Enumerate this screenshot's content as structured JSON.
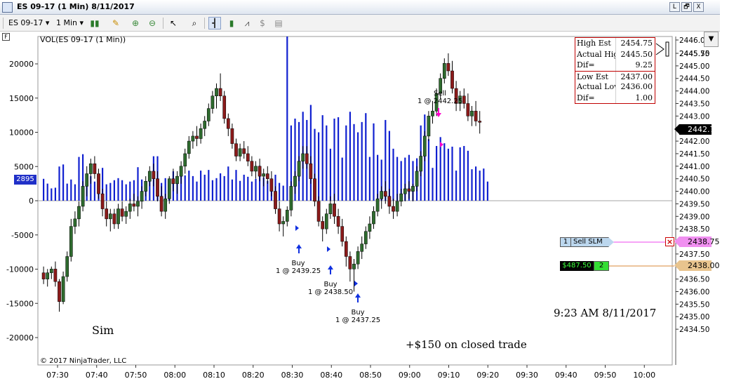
{
  "window": {
    "title": "ES 09-17 (1 Min)  8/11/2017",
    "icon": "chart-window-icon",
    "buttons": {
      "minimize": "L",
      "restore": "🗗",
      "close": "X"
    }
  },
  "toolbar": {
    "instrument": "ES 09-17",
    "interval": "1 Min",
    "icons": [
      "candlestick-icon",
      "pencil-icon",
      "zoom-in-icon",
      "zoom-out-icon",
      "pointer-icon",
      "crosshair-icon",
      "bar-chart-icon",
      "candle-style-icon",
      "line-chart-icon",
      "dollar-icon",
      "properties-icon"
    ]
  },
  "chart": {
    "flag": "F",
    "volume_label": "VOL(ES 09-17 (1 Min))",
    "volume_current": "2895",
    "copyright": "© 2017 NinjaTrader, LLC",
    "sim_label": "Sim",
    "closed_trade": "+$150 on closed trade",
    "timestamp": "9:23 AM 8/11/2017",
    "colors": {
      "up_bar": "#2e6b2e",
      "down_bar": "#8b1a1a",
      "volume": "#1020d0",
      "sell_order_line": "#f06ef0",
      "position_line": "#e0a060",
      "stats_border": "#c00000"
    }
  },
  "stats_table": [
    {
      "label": "High Est",
      "value": "2454.75"
    },
    {
      "label": "Actual High",
      "value": "2445.50"
    },
    {
      "label": "Dif=",
      "value": "9.25"
    },
    {
      "label": "Low Est",
      "value": "2437.00"
    },
    {
      "label": "Actual Low",
      "value": "2436.00"
    },
    {
      "label": "Dif=",
      "value": "1.00"
    }
  ],
  "annotations": {
    "buy1": {
      "title": "Buy",
      "detail": "1 @ 2439.25"
    },
    "buy2": {
      "title": "Buy",
      "detail": "1 @ 2438.50"
    },
    "buy3": {
      "title": "Buy",
      "detail": "1 @ 2437.25"
    },
    "sell1": {
      "title": "Sell",
      "detail": "1 @ 2442.25"
    }
  },
  "orders": {
    "sell_slm_qty": "1",
    "sell_slm_label": "Sell SLM",
    "sell_slm_price": "2438.75",
    "position_pnl": "$487.50",
    "position_qty": "2",
    "position_price": "2438.00",
    "cancel_icon": "close-icon"
  },
  "current_price": "2442.75",
  "chart_data": {
    "type": "candlestick-with-volume",
    "price_axis": {
      "ticks": [
        "2446.0",
        "2445.75",
        "2445.50",
        "2445.00",
        "2444.50",
        "2444.00",
        "2443.50",
        "2443.00",
        "2442.50",
        "2442.00",
        "2441.50",
        "2441.00",
        "2440.50",
        "2440.00",
        "2439.50",
        "2439.00",
        "2438.50",
        "2438.00",
        "2437.50",
        "2437.00",
        "2436.50",
        "2436.00",
        "2435.50",
        "2435.00",
        "2434.50"
      ]
    },
    "volume_axis": {
      "ticks": [
        "20000",
        "15000",
        "10000",
        "5000",
        "0",
        "-5000",
        "-10000",
        "-15000",
        "-20000"
      ]
    },
    "time_axis": {
      "ticks": [
        "07:30",
        "07:40",
        "07:50",
        "08:00",
        "08:10",
        "08:20",
        "08:30",
        "08:40",
        "08:50",
        "09:00",
        "09:10",
        "09:20",
        "09:30",
        "09:40",
        "09:50",
        "10:00"
      ]
    },
    "candles": [
      [
        2436.75,
        2437.0,
        2436.3,
        2436.5
      ],
      [
        2436.5,
        2436.9,
        2436.2,
        2436.75
      ],
      [
        2436.75,
        2437.0,
        2436.5,
        2436.9
      ],
      [
        2436.9,
        2437.2,
        2436.2,
        2436.4
      ],
      [
        2436.4,
        2436.5,
        2435.2,
        2435.6
      ],
      [
        2435.6,
        2436.8,
        2435.5,
        2436.6
      ],
      [
        2436.6,
        2437.6,
        2436.4,
        2437.4
      ],
      [
        2437.4,
        2438.9,
        2437.2,
        2438.6
      ],
      [
        2438.6,
        2439.2,
        2438.3,
        2438.9
      ],
      [
        2438.9,
        2439.6,
        2438.6,
        2439.4
      ],
      [
        2439.4,
        2440.4,
        2439.2,
        2440.2
      ],
      [
        2440.2,
        2441.0,
        2439.8,
        2440.7
      ],
      [
        2440.7,
        2441.3,
        2440.3,
        2441.1
      ],
      [
        2441.1,
        2441.4,
        2440.5,
        2440.7
      ],
      [
        2440.7,
        2440.9,
        2439.7,
        2439.9
      ],
      [
        2439.9,
        2440.1,
        2439.0,
        2439.3
      ],
      [
        2439.3,
        2439.6,
        2438.6,
        2438.9
      ],
      [
        2438.9,
        2439.3,
        2438.4,
        2439.1
      ],
      [
        2439.1,
        2439.3,
        2438.5,
        2438.7
      ],
      [
        2438.7,
        2439.5,
        2438.5,
        2439.3
      ],
      [
        2439.3,
        2439.6,
        2438.8,
        2439.0
      ],
      [
        2439.0,
        2439.4,
        2438.7,
        2439.2
      ],
      [
        2439.2,
        2439.7,
        2438.9,
        2439.5
      ],
      [
        2439.5,
        2439.9,
        2439.2,
        2439.4
      ],
      [
        2439.4,
        2439.8,
        2439.0,
        2439.6
      ],
      [
        2439.6,
        2440.2,
        2439.3,
        2440.0
      ],
      [
        2440.0,
        2440.6,
        2439.8,
        2440.4
      ],
      [
        2440.4,
        2441.0,
        2440.2,
        2440.8
      ],
      [
        2440.8,
        2441.1,
        2440.2,
        2440.5
      ],
      [
        2440.5,
        2440.8,
        2439.6,
        2439.8
      ],
      [
        2439.8,
        2440.2,
        2439.0,
        2439.2
      ],
      [
        2439.2,
        2439.9,
        2438.9,
        2439.7
      ],
      [
        2439.7,
        2440.6,
        2439.5,
        2440.5
      ],
      [
        2440.5,
        2440.9,
        2440.0,
        2440.3
      ],
      [
        2440.3,
        2440.8,
        2439.9,
        2440.6
      ],
      [
        2440.6,
        2441.2,
        2440.3,
        2441.0
      ],
      [
        2441.0,
        2441.7,
        2440.7,
        2441.5
      ],
      [
        2441.5,
        2442.2,
        2441.3,
        2442.0
      ],
      [
        2442.0,
        2442.4,
        2441.7,
        2442.2
      ],
      [
        2442.2,
        2442.6,
        2441.8,
        2442.1
      ],
      [
        2442.1,
        2442.7,
        2441.9,
        2442.5
      ],
      [
        2442.5,
        2443.0,
        2442.2,
        2442.8
      ],
      [
        2442.8,
        2443.5,
        2442.6,
        2443.3
      ],
      [
        2443.3,
        2444.0,
        2443.1,
        2443.8
      ],
      [
        2443.8,
        2444.3,
        2443.3,
        2444.1
      ],
      [
        2444.1,
        2444.7,
        2443.6,
        2443.8
      ],
      [
        2443.8,
        2444.0,
        2442.7,
        2442.9
      ],
      [
        2442.9,
        2443.1,
        2442.2,
        2442.5
      ],
      [
        2442.5,
        2442.7,
        2441.7,
        2441.9
      ],
      [
        2441.9,
        2442.1,
        2441.2,
        2441.4
      ],
      [
        2441.4,
        2441.9,
        2441.2,
        2441.7
      ],
      [
        2441.7,
        2442.0,
        2441.3,
        2441.5
      ],
      [
        2441.5,
        2441.8,
        2441.0,
        2441.2
      ],
      [
        2441.2,
        2441.4,
        2440.6,
        2440.8
      ],
      [
        2440.8,
        2441.2,
        2440.5,
        2441.0
      ],
      [
        2441.0,
        2441.3,
        2440.4,
        2440.6
      ],
      [
        2440.6,
        2440.9,
        2440.2,
        2440.7
      ],
      [
        2440.7,
        2441.0,
        2440.3,
        2440.5
      ],
      [
        2440.5,
        2440.8,
        2439.8,
        2440.0
      ],
      [
        2440.0,
        2440.2,
        2439.1,
        2439.3
      ],
      [
        2439.3,
        2439.6,
        2438.4,
        2438.7
      ],
      [
        2438.7,
        2439.0,
        2438.2,
        2438.8
      ],
      [
        2438.8,
        2439.4,
        2438.6,
        2439.25
      ],
      [
        2439.25,
        2440.4,
        2439.0,
        2440.2
      ],
      [
        2440.2,
        2440.8,
        2439.9,
        2440.6
      ],
      [
        2440.6,
        2441.4,
        2440.4,
        2441.2
      ],
      [
        2441.2,
        2441.8,
        2440.9,
        2441.5
      ],
      [
        2441.5,
        2441.8,
        2440.9,
        2441.1
      ],
      [
        2441.1,
        2441.4,
        2440.3,
        2440.5
      ],
      [
        2440.5,
        2440.7,
        2439.4,
        2439.6
      ],
      [
        2439.6,
        2439.8,
        2438.6,
        2438.8
      ],
      [
        2438.8,
        2439.0,
        2438.0,
        2438.5
      ],
      [
        2438.5,
        2439.3,
        2438.3,
        2439.1
      ],
      [
        2439.1,
        2439.8,
        2438.9,
        2439.5
      ],
      [
        2439.5,
        2439.9,
        2438.7,
        2439.0
      ],
      [
        2439.0,
        2439.3,
        2438.3,
        2438.6
      ],
      [
        2438.6,
        2438.9,
        2437.8,
        2438.0
      ],
      [
        2438.0,
        2438.2,
        2437.0,
        2437.4
      ],
      [
        2437.4,
        2437.6,
        2436.4,
        2436.9
      ],
      [
        2436.9,
        2437.3,
        2436.0,
        2437.1
      ],
      [
        2437.1,
        2437.8,
        2436.9,
        2437.6
      ],
      [
        2437.6,
        2438.2,
        2437.3,
        2437.9
      ],
      [
        2437.9,
        2438.6,
        2437.7,
        2438.4
      ],
      [
        2438.4,
        2439.0,
        2438.1,
        2438.7
      ],
      [
        2438.7,
        2439.4,
        2438.5,
        2439.2
      ],
      [
        2439.2,
        2439.9,
        2439.0,
        2439.7
      ],
      [
        2439.7,
        2440.2,
        2439.3,
        2440.0
      ],
      [
        2440.0,
        2440.4,
        2439.5,
        2439.8
      ],
      [
        2439.8,
        2440.1,
        2439.1,
        2439.4
      ],
      [
        2439.4,
        2439.7,
        2438.9,
        2439.2
      ],
      [
        2439.2,
        2439.9,
        2439.0,
        2439.6
      ],
      [
        2439.6,
        2440.1,
        2439.4,
        2439.9
      ],
      [
        2439.9,
        2440.3,
        2439.6,
        2440.1
      ],
      [
        2440.1,
        2440.4,
        2439.7,
        2440.0
      ],
      [
        2440.0,
        2440.3,
        2439.6,
        2440.2
      ],
      [
        2440.2,
        2441.0,
        2440.0,
        2440.8
      ],
      [
        2440.8,
        2441.6,
        2440.6,
        2441.4
      ],
      [
        2441.4,
        2442.4,
        2441.2,
        2442.2
      ],
      [
        2442.2,
        2443.2,
        2442.0,
        2443.0
      ],
      [
        2443.0,
        2443.6,
        2442.7,
        2443.2
      ],
      [
        2443.2,
        2444.1,
        2443.0,
        2443.9
      ],
      [
        2443.9,
        2444.7,
        2443.7,
        2444.5
      ],
      [
        2444.5,
        2445.3,
        2444.3,
        2445.1
      ],
      [
        2445.1,
        2445.5,
        2444.6,
        2444.8
      ],
      [
        2444.8,
        2445.2,
        2443.9,
        2444.1
      ],
      [
        2444.1,
        2444.4,
        2443.2,
        2443.5
      ],
      [
        2443.5,
        2444.0,
        2443.2,
        2443.8
      ],
      [
        2443.8,
        2444.1,
        2443.3,
        2443.5
      ],
      [
        2443.5,
        2443.9,
        2442.8,
        2443.0
      ],
      [
        2443.0,
        2443.4,
        2442.6,
        2443.2
      ],
      [
        2443.2,
        2443.6,
        2442.6,
        2442.8
      ],
      [
        2442.8,
        2443.2,
        2442.3,
        2442.75
      ]
    ],
    "volume": [
      3200,
      2500,
      1800,
      1900,
      5000,
      5300,
      2500,
      3100,
      2400,
      6400,
      6800,
      3000,
      3600,
      2800,
      3300,
      4800,
      2400,
      2600,
      3000,
      3300,
      3000,
      2400,
      2800,
      3000,
      4900,
      3100,
      2300,
      3300,
      6500,
      6500,
      2600,
      3300,
      2400,
      4300,
      3200,
      3900,
      3700,
      4400,
      3600,
      2800,
      4400,
      3800,
      4500,
      3000,
      3300,
      4000,
      3600,
      5000,
      3100,
      4500,
      2900,
      3800,
      3500,
      2800,
      3200,
      5100,
      3400,
      2900,
      2700,
      3800,
      2600,
      2200,
      24000,
      11000,
      12000,
      11500,
      13000,
      11800,
      14000,
      10500,
      10000,
      12500,
      11000,
      7600,
      12000,
      12200,
      6300,
      11000,
      13000,
      11200,
      10000,
      11500,
      12800,
      6400,
      11300,
      6700,
      6000,
      11800,
      10200,
      7600,
      6400,
      5800,
      6300,
      6700,
      5800,
      6200,
      11000,
      12600,
      9000,
      4800,
      8000,
      9300,
      8400,
      7600,
      7900,
      4400,
      7800,
      8000,
      7300,
      4600,
      5000,
      4400,
      4700,
      2800
    ]
  }
}
